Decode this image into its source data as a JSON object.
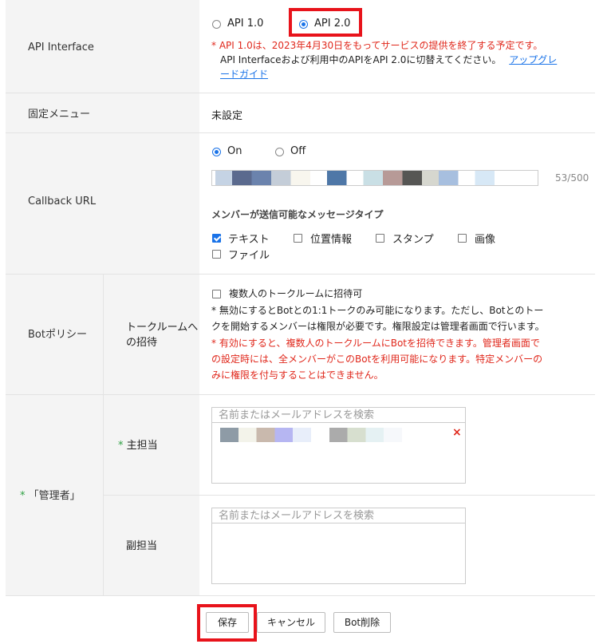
{
  "api_interface": {
    "label": "API Interface",
    "option1": "API 1.0",
    "option2": "API 2.0",
    "notice_line1": "* API 1.0は、2023年4月30日をもってサービスの提供を終了する予定です。",
    "notice_line2": "API Interfaceおよび利用中のAPIをAPI 2.0に切替えてください。",
    "upgrade_link_line1": "アップグレ",
    "upgrade_link_line2": "ードガイド"
  },
  "fixed_menu": {
    "label": "固定メニュー",
    "value": "未設定"
  },
  "callback": {
    "label": "Callback URL",
    "on_label": "On",
    "off_label": "Off",
    "char_count": "53/500",
    "message_types_heading": "メンバーが送信可能なメッセージタイプ",
    "types": [
      {
        "label": "テキスト",
        "checked": true
      },
      {
        "label": "位置情報",
        "checked": false
      },
      {
        "label": "スタンプ",
        "checked": false
      },
      {
        "label": "画像",
        "checked": false
      },
      {
        "label": "ファイル",
        "checked": false
      }
    ]
  },
  "bot_policy": {
    "label": "Botポリシー",
    "sub_label_line1": "トークルームへ",
    "sub_label_line2": "の招待",
    "checkbox_label": "複数人のトークルームに招待可",
    "note1_line1": "* 無効にするとBotとの1:1トークのみ可能になります。ただし、Botとのトー",
    "note1_line2": "クを開始するメンバーは権限が必要です。権限設定は管理者画面で行います。",
    "note2_line1": "* 有効にすると、複数人のトークルームにBotを招待できます。管理者画面で",
    "note2_line2": "の設定時には、全メンバーがこのBotを利用可能になります。特定メンバーの",
    "note2_line3": "みに権限を付与することはできません。"
  },
  "admin": {
    "label_mark": "*",
    "label": "「管理者」",
    "primary_mark": "*",
    "primary_label": "主担当",
    "secondary_label": "副担当",
    "search_placeholder": "名前またはメールアドレスを検索",
    "remove_icon_char": "×"
  },
  "buttons": {
    "save": "保存",
    "cancel": "キャンセル",
    "delete": "Bot削除"
  },
  "colors": {
    "accent": "#1a73e8",
    "warning": "#e0281c",
    "highlight": "#e8131b",
    "required": "#2ea043"
  }
}
